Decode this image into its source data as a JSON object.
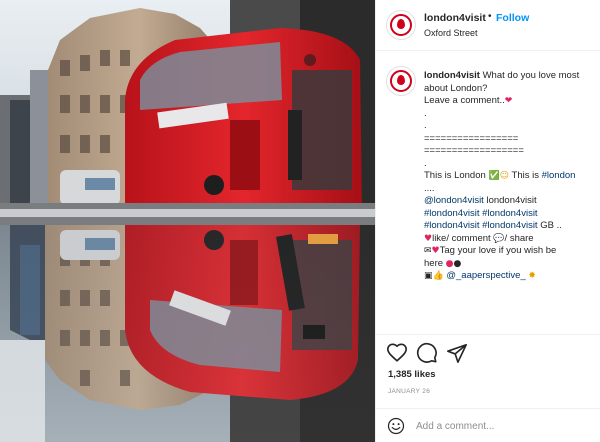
{
  "post": {
    "username": "london4visit",
    "follow_label": "Follow",
    "separator": "•",
    "location": "Oxford Street",
    "likes": "1,385 likes",
    "date": "JANUARY 26",
    "comment_placeholder": "Add a comment..."
  },
  "caption": {
    "username": "london4visit",
    "text_line1": "What do you love most",
    "text_line2": "about London?",
    "text_line3": "Leave a comment..",
    "dot1": ".",
    "dot2": ".",
    "rule1": "=================",
    "rule2": "==================",
    "dot3": ".",
    "this_is_london": "This is London",
    "this_is": "This is",
    "hashtag_london": "#london",
    "ellipsis": "....",
    "mention_line_tag": "@london4visit",
    "mention_line_text": "london4visit",
    "tags_line1a": "#london4visit",
    "tags_line1b": "#london4visit",
    "tags_line2a": "#london4visit",
    "tags_line2b": "#london4visit",
    "tags_line2c": "GB ..",
    "like_comment": "like/ comment",
    "share": "/ share",
    "tag_love": "Tag your love if you wish be",
    "here": "here",
    "credit_tag": "@_aaperspective_"
  },
  "icons": {
    "like": "heart-outline-icon",
    "comment": "speech-bubble-icon",
    "share": "paper-plane-icon",
    "emoji": "smiley-face-icon"
  },
  "colors": {
    "follow": "#0095f6",
    "hashtag": "#00376b",
    "bus_red": "#d4161e",
    "muted": "#8e8e8e"
  }
}
